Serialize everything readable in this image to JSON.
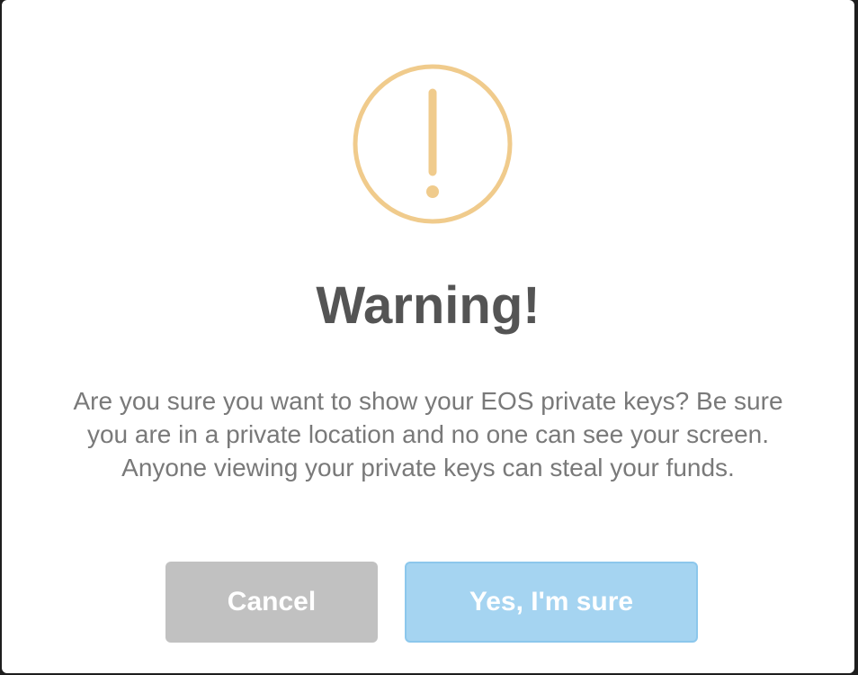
{
  "dialog": {
    "icon": "warning-exclamation-icon",
    "icon_color": "#f0cb8c",
    "title": "Warning!",
    "message_lines": [
      "Are you sure you want to show your EOS private keys? Be sure",
      "you are in a private location and no one can see your screen.",
      "Anyone viewing your private keys can steal your funds."
    ],
    "cancel_label": "Cancel",
    "confirm_label": "Yes, I'm sure",
    "cancel_color": "#c1c1c1",
    "confirm_color": "#a5d4f1"
  }
}
